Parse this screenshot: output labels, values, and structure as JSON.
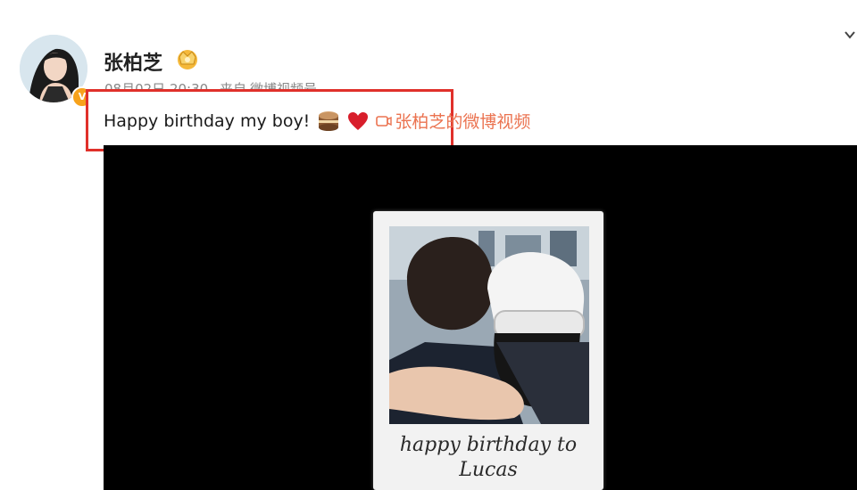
{
  "user": {
    "name": "张柏芝",
    "badge_icon": "crown-badge-icon",
    "verified_icon": "v-verified-icon"
  },
  "meta": {
    "timestamp": "08月02日 20:30",
    "source_prefix": "来自",
    "source": "微博视频号"
  },
  "post": {
    "text": "Happy birthday my boy!",
    "emojis": [
      "cake-icon",
      "heart-icon"
    ],
    "video_link": "张柏芝的微博视频"
  },
  "media": {
    "handwriting_line1": "happy birthday to",
    "handwriting_line2": "Lucas"
  },
  "colors": {
    "highlight_border": "#e0302a",
    "link": "#eb7350",
    "verified": "#f7a21b",
    "media_bg": "#000000"
  }
}
